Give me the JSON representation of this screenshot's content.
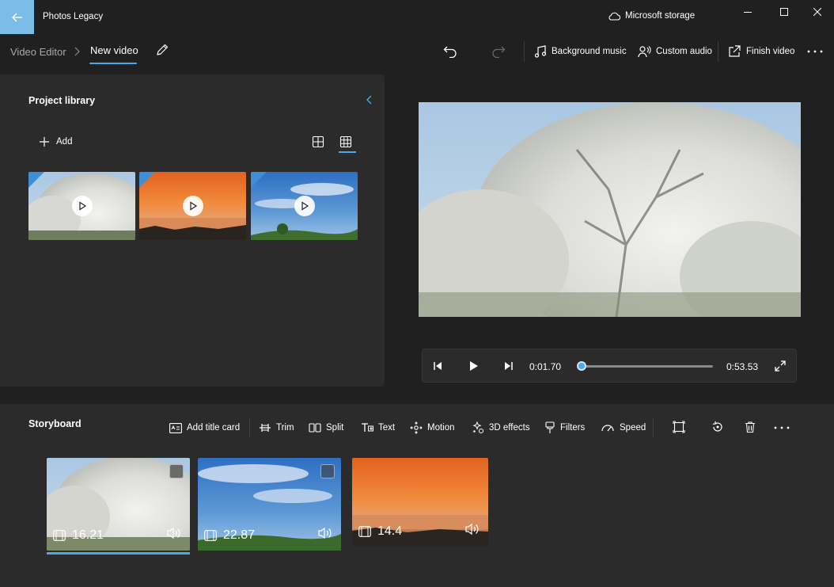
{
  "app": {
    "title": "Photos Legacy",
    "storage_label": "Microsoft storage"
  },
  "breadcrumb": {
    "root": "Video Editor",
    "current": "New video"
  },
  "commands": {
    "background_music": "Background music",
    "custom_audio": "Custom audio",
    "finish_video": "Finish video"
  },
  "library": {
    "title": "Project library",
    "add_label": "Add",
    "items": [
      {
        "type": "video",
        "scene": "cherry-blossom"
      },
      {
        "type": "video",
        "scene": "sunset"
      },
      {
        "type": "video",
        "scene": "blue-sky"
      }
    ]
  },
  "player": {
    "current_time": "0:01.70",
    "total_time": "0:53.53",
    "progress": 0.03
  },
  "storyboard": {
    "title": "Storyboard",
    "tools": {
      "add_title_card": "Add title card",
      "trim": "Trim",
      "split": "Split",
      "text": "Text",
      "motion": "Motion",
      "effects_3d": "3D effects",
      "filters": "Filters",
      "speed": "Speed"
    },
    "clips": [
      {
        "duration": "16.21",
        "scene": "cherry-blossom",
        "selected": true
      },
      {
        "duration": "22.87",
        "scene": "blue-sky",
        "selected": false
      },
      {
        "duration": "14.4",
        "scene": "sunset",
        "selected": false
      }
    ]
  },
  "colors": {
    "accent": "#4ea7e6",
    "back_button": "#7cbde8",
    "background": "#202020",
    "panel": "#2b2b2b"
  }
}
